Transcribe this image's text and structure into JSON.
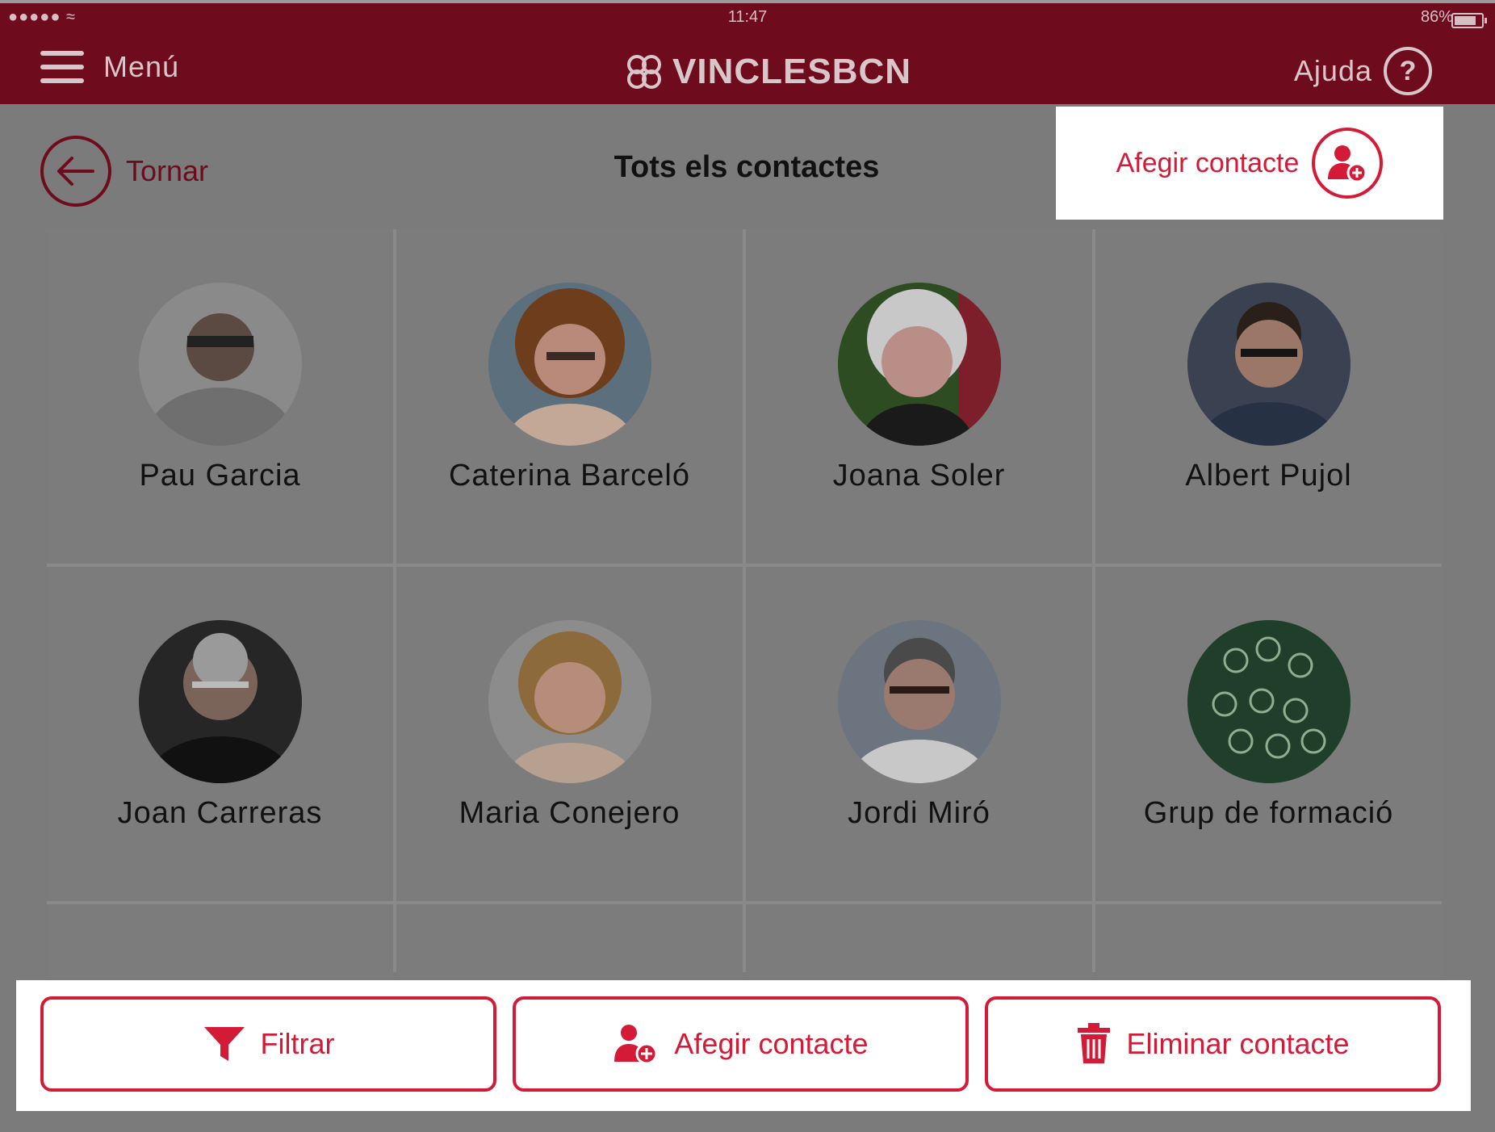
{
  "status_bar": {
    "signal": "●●●●● ≈",
    "time": "11:47",
    "battery": "86%"
  },
  "header": {
    "menu_label": "Menú",
    "logo_text": "VINCLESBCN",
    "help_label": "Ajuda",
    "help_symbol": "?"
  },
  "nav": {
    "back_label": "Tornar",
    "title": "Tots els contactes",
    "add_label": "Afegir contacte"
  },
  "contacts": [
    {
      "name": "Pau Garcia"
    },
    {
      "name": "Caterina Barceló"
    },
    {
      "name": "Joana Soler"
    },
    {
      "name": "Albert Pujol"
    },
    {
      "name": "Joan Carreras"
    },
    {
      "name": "Maria Conejero"
    },
    {
      "name": "Jordi Miró"
    },
    {
      "name": "Grup de formació"
    }
  ],
  "actions": {
    "filter": "Filtrar",
    "add": "Afegir contacte",
    "delete": "Eliminar contacte"
  },
  "colors": {
    "brand": "#6e0b1c",
    "accent": "#d31a36",
    "overlay": "#7b7b7b"
  }
}
